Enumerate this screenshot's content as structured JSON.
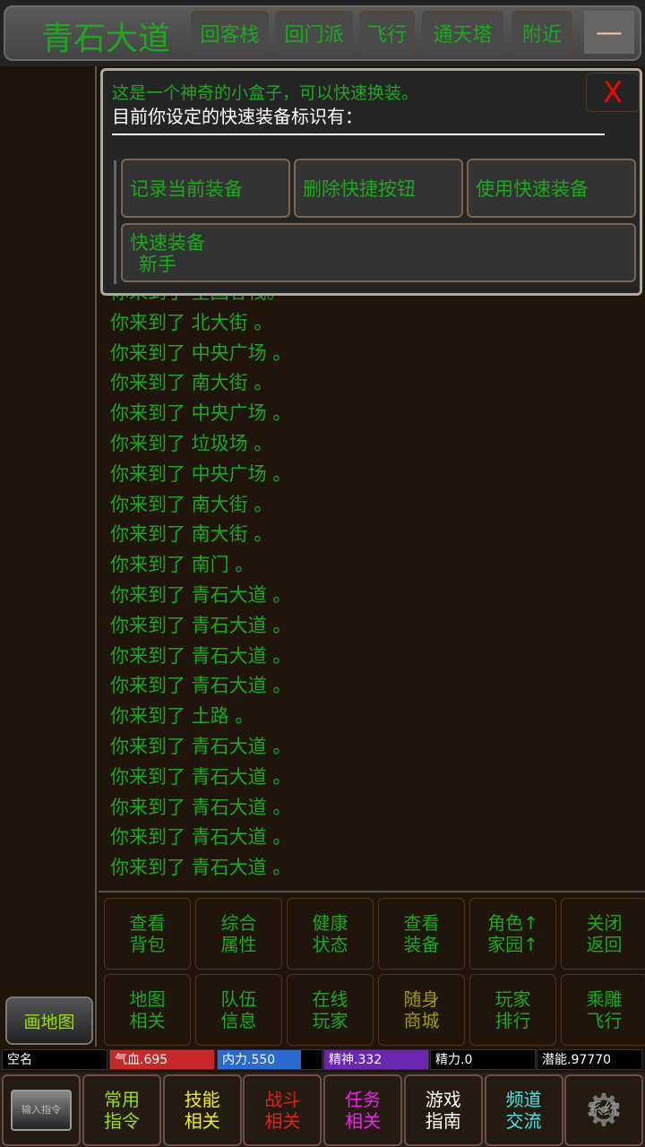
{
  "header": {
    "location": "青石大道",
    "buttons": [
      "回客栈",
      "回门派",
      "飞行",
      "通天塔",
      "附近"
    ],
    "menu_label": "—"
  },
  "dialog": {
    "intro": "这是一个神奇的小盒子，可以快速换装。",
    "subtitle": "目前你设定的快速装备标识有：",
    "close_label": "X",
    "buttons": [
      "记录当前装备",
      "删除快捷按钮",
      "使用快速装备"
    ],
    "preset": {
      "label": "快速装备",
      "name": "新手"
    }
  },
  "log": [
    "你来到了 全国客栈。",
    "你来到了 北大街 。",
    "你来到了 中央广场 。",
    "你来到了 南大街 。",
    "你来到了 中央广场 。",
    "你来到了 垃圾场 。",
    "你来到了 中央广场 。",
    "你来到了 南大街 。",
    "你来到了 南大街 。",
    "你来到了 南门 。",
    "你来到了 青石大道 。",
    "你来到了 青石大道 。",
    "你来到了 青石大道 。",
    "你来到了 青石大道 。",
    "你来到了 土路 。",
    "你来到了 青石大道 。",
    "你来到了 青石大道 。",
    "你来到了 青石大道 。",
    "你来到了 青石大道 。",
    "你来到了 青石大道 。"
  ],
  "actions": [
    {
      "label": "查看\n背包",
      "color": "#1ca81c"
    },
    {
      "label": "综合\n属性",
      "color": "#1ca81c"
    },
    {
      "label": "健康\n状态",
      "color": "#1ca81c"
    },
    {
      "label": "查看\n装备",
      "color": "#1ca81c"
    },
    {
      "label": "角色↑\n家园↑",
      "color": "#1ca81c"
    },
    {
      "label": "关闭\n返回",
      "color": "#1ca81c"
    },
    {
      "label": "地图\n相关",
      "color": "#1ca81c"
    },
    {
      "label": "队伍\n信息",
      "color": "#1ca81c"
    },
    {
      "label": "在线\n玩家",
      "color": "#1ca81c"
    },
    {
      "label": "随身\n商城",
      "color": "#a09a10"
    },
    {
      "label": "玩家\n排行",
      "color": "#1ca81c"
    },
    {
      "label": "乘雕\n飞行",
      "color": "#1ca81c"
    }
  ],
  "map_button": "画地图",
  "status": {
    "name": "空名",
    "hp": "气血.695",
    "mp": "内力.550",
    "mp_fill": 0.8,
    "spirit": "精神.332",
    "energy": "精力.0",
    "potential": "潜能.97770"
  },
  "bottom": {
    "input_label": "输入指令",
    "system_label": "系统",
    "buttons": [
      {
        "label": "常用\n指令",
        "color": "#9be000"
      },
      {
        "label": "技能\n相关",
        "color": "#f0f000"
      },
      {
        "label": "战斗\n相关",
        "color": "#e02020"
      },
      {
        "label": "任务\n相关",
        "color": "#f020f0"
      },
      {
        "label": "游戏\n指南",
        "color": "#ffffff"
      },
      {
        "label": "频道\n交流",
        "color": "#50e0e0"
      }
    ]
  }
}
